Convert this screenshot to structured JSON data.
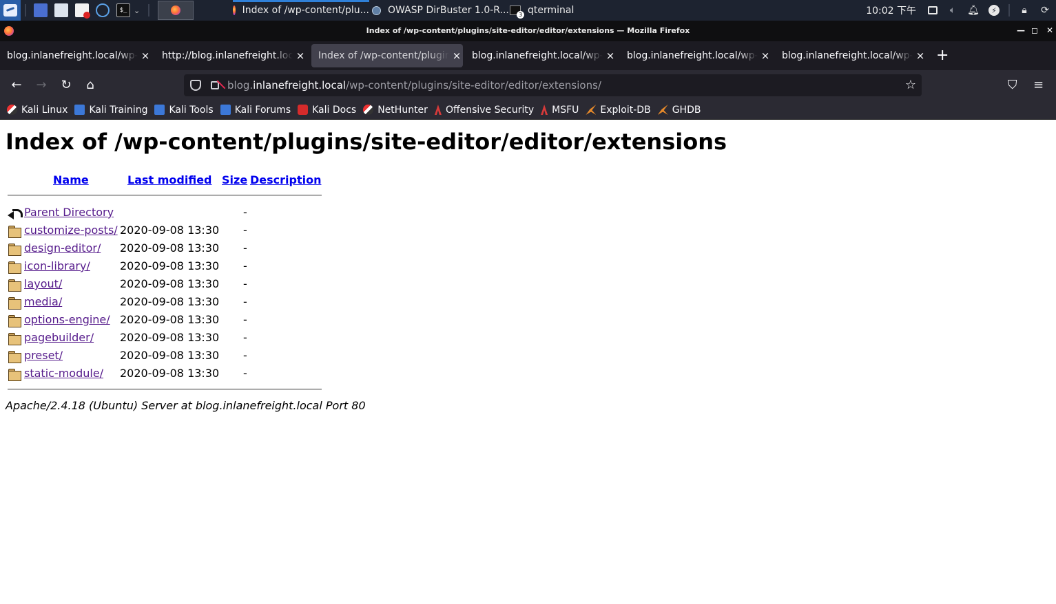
{
  "taskbar": {
    "tasks": [
      {
        "label": "Index of /wp-content/plu..."
      },
      {
        "label": "OWASP DirBuster 1.0-R..."
      },
      {
        "label": "qterminal"
      }
    ],
    "clock": "10:02 下午"
  },
  "window": {
    "title": "Index of /wp-content/plugins/site-editor/editor/extensions — Mozilla Firefox"
  },
  "tabs": [
    {
      "label": "blog.inlanefreight.local/wp-content/plugins"
    },
    {
      "label": "http://blog.inlanefreight.local/wp-content"
    },
    {
      "label": "Index of /wp-content/plugins/site-editor/editor"
    },
    {
      "label": "blog.inlanefreight.local/wp-content/plugins"
    },
    {
      "label": "blog.inlanefreight.local/wp-content/plugins"
    },
    {
      "label": "blog.inlanefreight.local/wp-content/plugins"
    }
  ],
  "urlbar": {
    "prefix": "blog.",
    "host": "inlanefreight.local",
    "path": "/wp-content/plugins/site-editor/editor/extensions/"
  },
  "bookmarks": [
    {
      "label": "Kali Linux",
      "icon": "kali-icon"
    },
    {
      "label": "Kali Training",
      "icon": "kali-training-icon"
    },
    {
      "label": "Kali Tools",
      "icon": "kali-tools-icon"
    },
    {
      "label": "Kali Forums",
      "icon": "kali-forums-icon"
    },
    {
      "label": "Kali Docs",
      "icon": "kali-docs-icon"
    },
    {
      "label": "NetHunter",
      "icon": "nethunter-icon"
    },
    {
      "label": "Offensive Security",
      "icon": "offsec-icon"
    },
    {
      "label": "MSFU",
      "icon": "msfu-icon"
    },
    {
      "label": "Exploit-DB",
      "icon": "exploit-db-icon"
    },
    {
      "label": "GHDB",
      "icon": "ghdb-icon"
    }
  ],
  "page": {
    "heading": "Index of /wp-content/plugins/site-editor/editor/extensions",
    "columns": {
      "name": "Name",
      "modified": "Last modified",
      "size": "Size",
      "description": "Description"
    },
    "parent": {
      "name": "Parent Directory",
      "size": "-"
    },
    "entries": [
      {
        "name": "customize-posts/",
        "modified": "2020-09-08 13:30",
        "size": "-"
      },
      {
        "name": "design-editor/",
        "modified": "2020-09-08 13:30",
        "size": "-"
      },
      {
        "name": "icon-library/",
        "modified": "2020-09-08 13:30",
        "size": "-"
      },
      {
        "name": "layout/",
        "modified": "2020-09-08 13:30",
        "size": "-"
      },
      {
        "name": "media/",
        "modified": "2020-09-08 13:30",
        "size": "-"
      },
      {
        "name": "options-engine/",
        "modified": "2020-09-08 13:30",
        "size": "-"
      },
      {
        "name": "pagebuilder/",
        "modified": "2020-09-08 13:30",
        "size": "-"
      },
      {
        "name": "preset/",
        "modified": "2020-09-08 13:30",
        "size": "-"
      },
      {
        "name": "static-module/",
        "modified": "2020-09-08 13:30",
        "size": "-"
      }
    ],
    "address": "Apache/2.4.18 (Ubuntu) Server at blog.inlanefreight.local Port 80"
  }
}
